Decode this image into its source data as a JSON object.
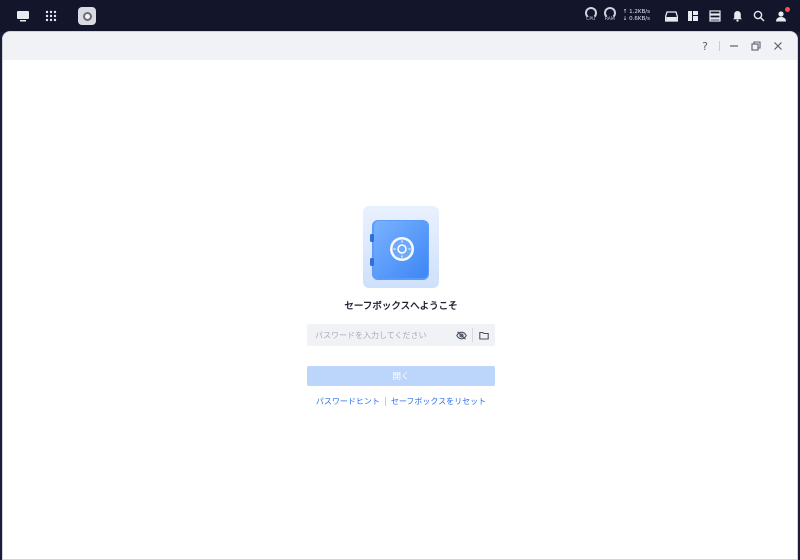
{
  "taskbar": {
    "icons": [
      "desktop-icon",
      "apps-grid-icon",
      "safebox-app-icon"
    ],
    "cpu_label": "CPU",
    "ram_label": "RAM",
    "upload_speed": "↑ 1.2KB/s",
    "download_speed": "↓ 0.6KB/s",
    "right_icons": [
      "storage-icon",
      "dashboard-icon",
      "server-icon",
      "bell-icon",
      "search-icon",
      "user-icon"
    ],
    "notification_color": "#ff4d4f"
  },
  "window": {
    "controls": {
      "help": "?",
      "minimize": "—",
      "restore": "❐",
      "close": "✕"
    }
  },
  "main": {
    "title": "セーフボックスへようこそ",
    "password_placeholder": "パスワードを入力してください",
    "password_value": "",
    "open_button": "開く",
    "password_hint_link": "パスワードヒント",
    "reset_link": "セーフボックスをリセット"
  },
  "colors": {
    "accent": "#2a6df0",
    "button_disabled": "#bcd6fb",
    "taskbar": "#13162b"
  }
}
